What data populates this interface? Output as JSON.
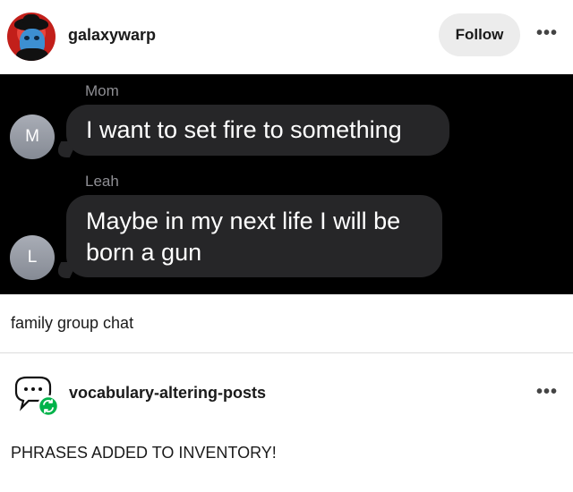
{
  "post": {
    "username": "galaxywarp",
    "follow_label": "Follow",
    "more_label": "•••"
  },
  "chat": {
    "messages": [
      {
        "sender": "Mom",
        "initial": "M",
        "text": "I want to set fire to something"
      },
      {
        "sender": "Leah",
        "initial": "L",
        "text": "Maybe in my next life I will be born a gun"
      }
    ]
  },
  "caption": "family group chat",
  "reblog": {
    "username": "vocabulary-altering-posts",
    "more_label": "•••",
    "text": "PHRASES ADDED TO INVENTORY!"
  },
  "colors": {
    "chat_background": "#000000",
    "bubble": "#262628",
    "reblog_badge": "#00b34a"
  }
}
